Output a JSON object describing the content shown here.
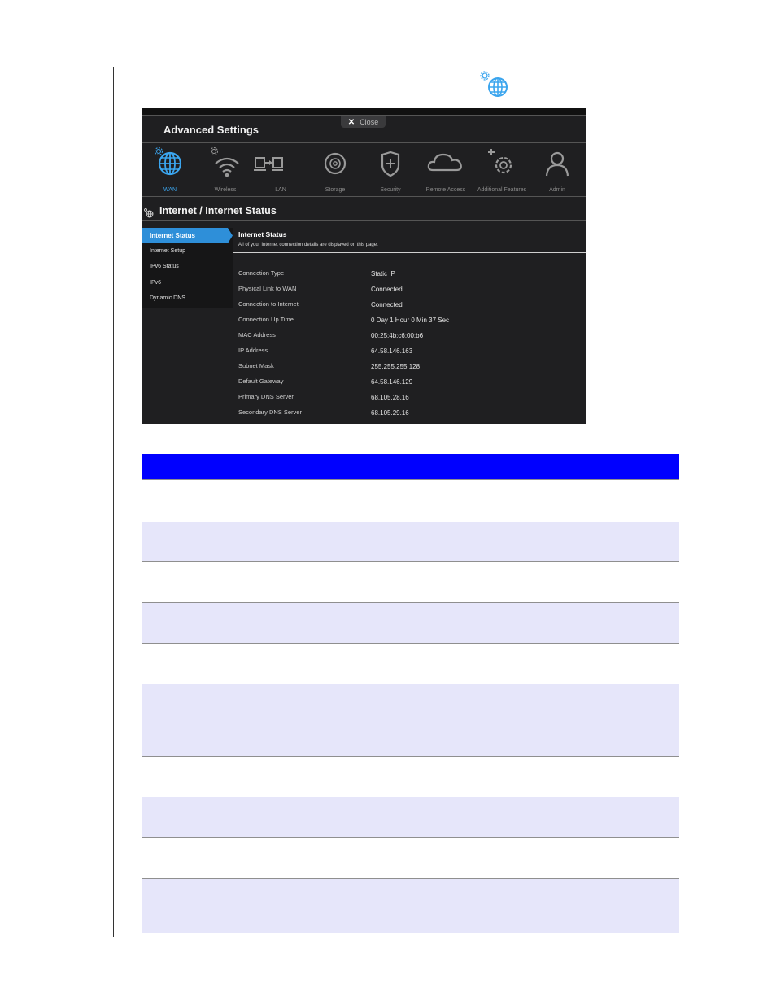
{
  "header_icon": "wan-settings-globe-icon",
  "screenshot": {
    "close_label": "Close",
    "window_title": "Advanced Settings",
    "nav": [
      {
        "label": "WAN",
        "icon": "globe-icon",
        "active": true
      },
      {
        "label": "Wireless",
        "icon": "wifi-icon",
        "active": false
      },
      {
        "label": "LAN",
        "icon": "lan-icon",
        "active": false
      },
      {
        "label": "Storage",
        "icon": "storage-icon",
        "active": false
      },
      {
        "label": "Security",
        "icon": "shield-icon",
        "active": false
      },
      {
        "label": "Remote Access",
        "icon": "cloud-icon",
        "active": false
      },
      {
        "label": "Additional Features",
        "icon": "gear-plus-icon",
        "active": false
      },
      {
        "label": "Admin",
        "icon": "user-icon",
        "active": false
      }
    ],
    "section_title": "Internet / Internet Status",
    "sidebar": [
      {
        "label": "Internet Status",
        "active": true
      },
      {
        "label": "Internet Setup",
        "active": false
      },
      {
        "label": "IPv6 Status",
        "active": false
      },
      {
        "label": "IPv6",
        "active": false
      },
      {
        "label": "Dynamic DNS",
        "active": false
      }
    ],
    "content_title": "Internet Status",
    "content_subtitle": "All of your Internet connection details are displayed on this page.",
    "rows": [
      {
        "label": "Connection Type",
        "value": "Static IP"
      },
      {
        "label": "Physical Link to WAN",
        "value": "Connected"
      },
      {
        "label": "Connection to Internet",
        "value": "Connected"
      },
      {
        "label": "Connection Up Time",
        "value": "0 Day 1 Hour 0 Min 37 Sec"
      },
      {
        "label": "MAC Address",
        "value": "00:25:4b:c6:00:b6"
      },
      {
        "label": "IP Address",
        "value": "64.58.146.163"
      },
      {
        "label": "Subnet Mask",
        "value": "255.255.255.128"
      },
      {
        "label": "Default Gateway",
        "value": "64.58.146.129"
      },
      {
        "label": "Primary DNS Server",
        "value": "68.105.28.16"
      },
      {
        "label": "Secondary DNS Server",
        "value": "68.105.29.16"
      }
    ]
  },
  "colors": {
    "accent": "#3ba5ee",
    "table_header": "#0000ff",
    "table_shade": "#e6e6fa"
  }
}
